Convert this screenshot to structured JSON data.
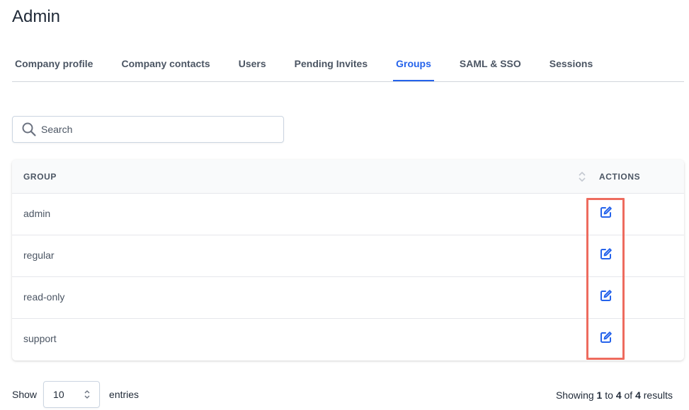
{
  "page": {
    "title": "Admin"
  },
  "tabs": [
    {
      "label": "Company profile",
      "active": false
    },
    {
      "label": "Company contacts",
      "active": false
    },
    {
      "label": "Users",
      "active": false
    },
    {
      "label": "Pending Invites",
      "active": false
    },
    {
      "label": "Groups",
      "active": true
    },
    {
      "label": "SAML & SSO",
      "active": false
    },
    {
      "label": "Sessions",
      "active": false
    }
  ],
  "search": {
    "placeholder": "Search",
    "value": ""
  },
  "table": {
    "columns": {
      "group": "GROUP",
      "actions": "ACTIONS"
    },
    "rows": [
      {
        "group": "admin",
        "action_icon": "edit-icon"
      },
      {
        "group": "regular",
        "action_icon": "edit-icon"
      },
      {
        "group": "read-only",
        "action_icon": "edit-icon"
      },
      {
        "group": "support",
        "action_icon": "edit-icon"
      }
    ]
  },
  "footer": {
    "show_label": "Show",
    "page_size": "10",
    "entries_label": "entries",
    "summary": {
      "prefix": "Showing",
      "from": "1",
      "to_label": "to",
      "to": "4",
      "of_label": "of",
      "total": "4",
      "suffix": "results"
    }
  },
  "colors": {
    "accent": "#2563eb",
    "highlight": "#ee6b5e",
    "text_muted": "#4b5563"
  },
  "icons": {
    "search": "search-icon",
    "sort": "sort-icon",
    "edit": "edit-icon",
    "stepper": "chevron-up-down-icon"
  }
}
